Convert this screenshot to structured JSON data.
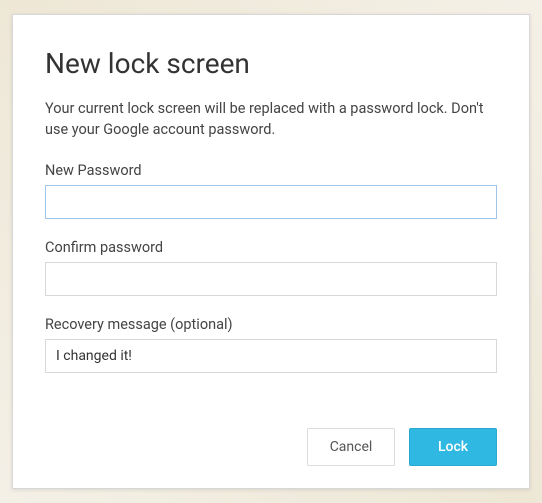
{
  "dialog": {
    "title": "New lock screen",
    "description": "Your current lock screen will be replaced with a password lock. Don't use your Google account password."
  },
  "fields": {
    "new_password": {
      "label": "New Password",
      "value": ""
    },
    "confirm_password": {
      "label": "Confirm password",
      "value": ""
    },
    "recovery_message": {
      "label": "Recovery message (optional)",
      "value": "I changed it!"
    }
  },
  "actions": {
    "cancel_label": "Cancel",
    "lock_label": "Lock"
  }
}
